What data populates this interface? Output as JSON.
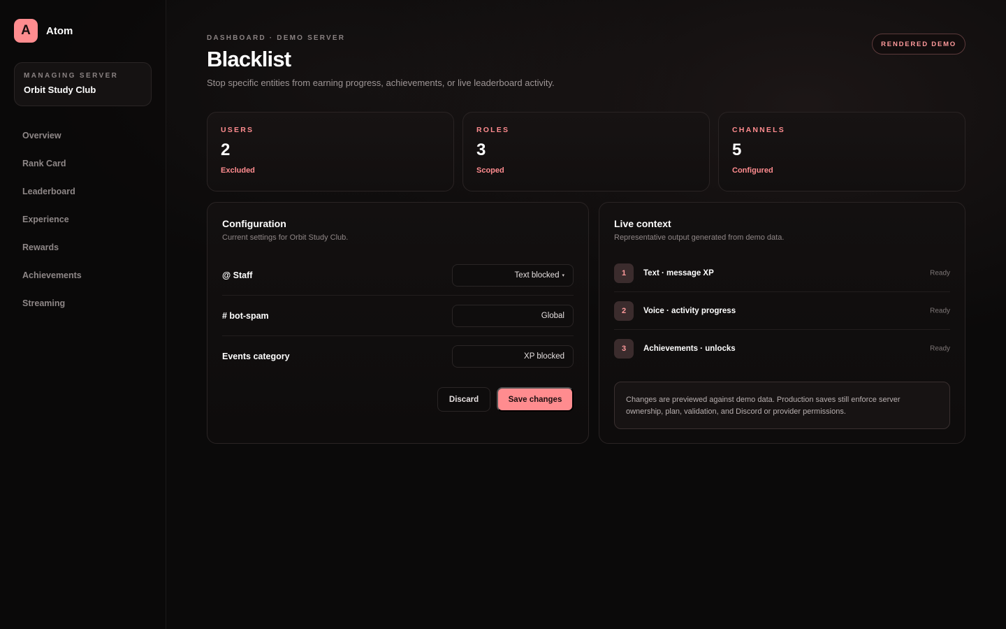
{
  "brand": {
    "logo_letter": "A",
    "name": "Atom"
  },
  "server": {
    "label": "MANAGING SERVER",
    "name": "Orbit Study Club"
  },
  "nav": {
    "items": [
      {
        "label": "Overview"
      },
      {
        "label": "Rank Card"
      },
      {
        "label": "Leaderboard"
      },
      {
        "label": "Experience"
      },
      {
        "label": "Rewards"
      },
      {
        "label": "Achievements"
      },
      {
        "label": "Streaming"
      }
    ]
  },
  "header": {
    "breadcrumb": "DASHBOARD · DEMO SERVER",
    "title": "Blacklist",
    "subtitle": "Stop specific entities from earning progress, achievements, or live leaderboard activity.",
    "badge": "RENDERED DEMO"
  },
  "stats": [
    {
      "label": "USERS",
      "value": "2",
      "sub": "Excluded"
    },
    {
      "label": "ROLES",
      "value": "3",
      "sub": "Scoped"
    },
    {
      "label": "CHANNELS",
      "value": "5",
      "sub": "Configured"
    }
  ],
  "config": {
    "title": "Configuration",
    "subtitle": "Current settings for Orbit Study Club.",
    "rows": [
      {
        "label": "@ Staff",
        "value": "Text blocked",
        "caret": "▾"
      },
      {
        "label": "# bot-spam",
        "value": "Global"
      },
      {
        "label": "Events category",
        "value": "XP blocked"
      }
    ],
    "discard_label": "Discard",
    "save_label": "Save changes"
  },
  "context": {
    "title": "Live context",
    "subtitle": "Representative output generated from demo data.",
    "rows": [
      {
        "num": "1",
        "label": "Text · message XP",
        "status": "Ready"
      },
      {
        "num": "2",
        "label": "Voice · activity progress",
        "status": "Ready"
      },
      {
        "num": "3",
        "label": "Achievements · unlocks",
        "status": "Ready"
      }
    ],
    "notice": "Changes are previewed against demo data. Production saves still enforce server ownership, plan, validation, and Discord or provider permissions."
  },
  "colors": {
    "accent": "#ff8c8f",
    "background": "#0b0a0a"
  }
}
